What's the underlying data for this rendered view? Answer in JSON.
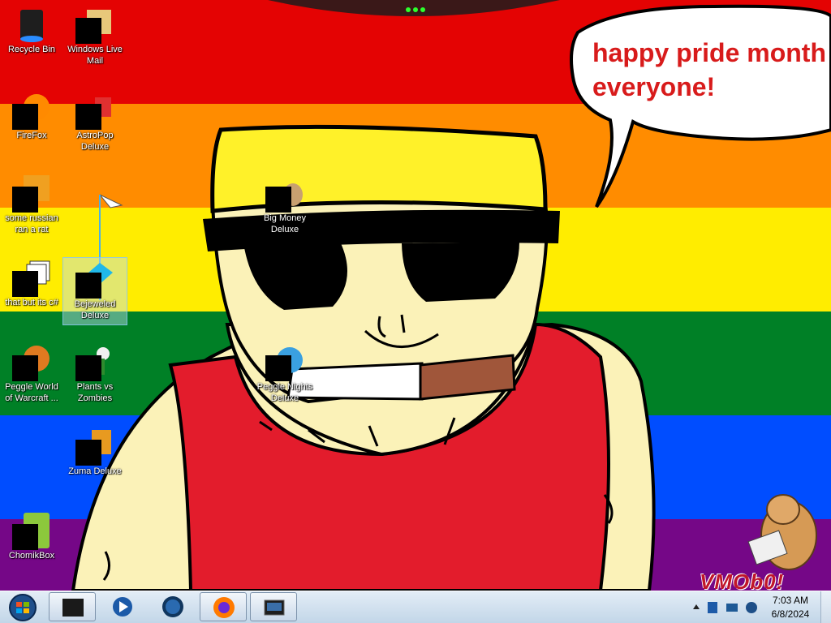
{
  "desktop": {
    "speech_text": "happy pride month everyone!",
    "watermark": "VMOb0!",
    "icons": [
      {
        "label": "Recycle Bin"
      },
      {
        "label": "Windows Live Mail"
      },
      {
        "label": "FireFox"
      },
      {
        "label": "AstroPop Deluxe"
      },
      {
        "label": "some russian ran a rat"
      },
      {
        "label": "Big Money Deluxe"
      },
      {
        "label": "that but its c#"
      },
      {
        "label": "Bejeweled Deluxe"
      },
      {
        "label": "Peggle World of Warcraft ..."
      },
      {
        "label": "Plants vs Zombies"
      },
      {
        "label": "Peggle Nights Deluxe"
      },
      {
        "label": "Zuma Deluxe"
      },
      {
        "label": "ChomikBox"
      }
    ]
  },
  "taskbar": {
    "start_icon": "windows-orb-icon",
    "pinned": [
      {
        "icon": "black-box-app-icon"
      },
      {
        "icon": "media-player-icon"
      },
      {
        "icon": "globe-icon"
      },
      {
        "icon": "firefox-icon"
      },
      {
        "icon": "monitor-window-icon"
      }
    ],
    "clock": {
      "time": "7:03 AM",
      "date": "6/8/2024"
    }
  },
  "colors": {
    "stripe_red": "#e40303",
    "stripe_orange": "#ff8c00",
    "stripe_yellow": "#ffed00",
    "stripe_green": "#008026",
    "stripe_blue": "#004dff",
    "stripe_purple": "#750787",
    "skin": "#fbf2b8",
    "speech_text": "#d81b1b"
  }
}
